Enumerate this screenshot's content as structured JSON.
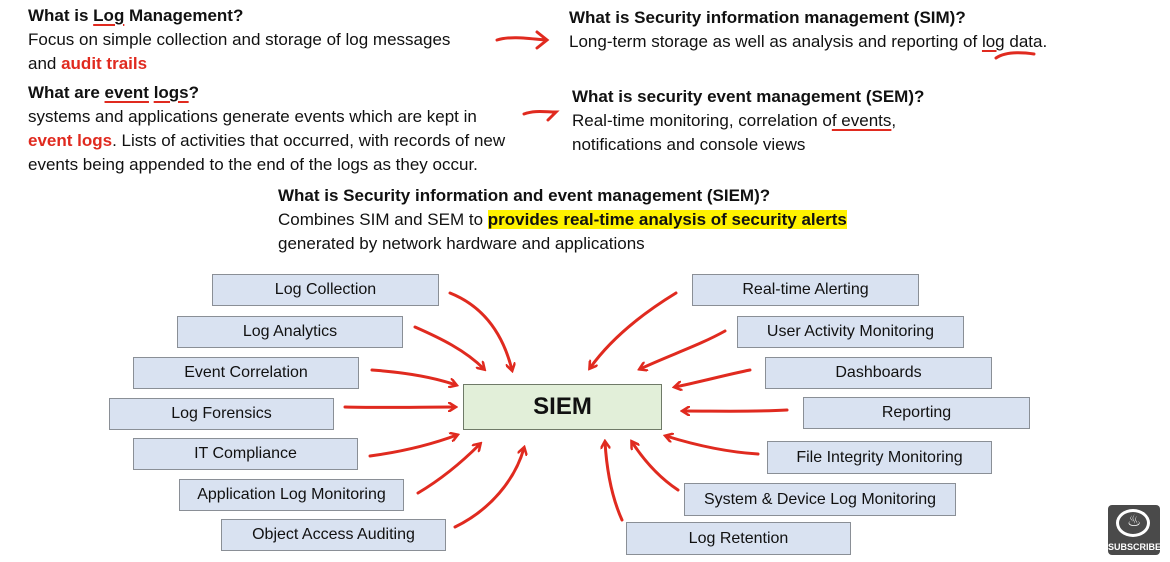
{
  "log_mgmt": {
    "title_pre": "What is ",
    "title_u": "Log",
    "title_post": " Management?",
    "body_line1": "Focus on simple collection and storage of log messages",
    "body_line2_pre": "and ",
    "body_line2_red": "audit trails"
  },
  "event_logs": {
    "title_pre": "What are ",
    "title_u1": "event",
    "title_mid": " ",
    "title_u2": "logs",
    "title_post": "?",
    "line1": "systems and applications generate events which are kept in",
    "line2_red": "event logs",
    "line2_rest": ". Lists of activities that occurred, with records of new",
    "line3": "events being appended to the end of the logs as they occur."
  },
  "sim": {
    "title": "What is Security information management (SIM)?",
    "body_pre": "Long-term storage as well as analysis and reporting of ",
    "body_u": "log",
    "body_post": " data."
  },
  "sem": {
    "title": "What is security event management (SEM)?",
    "line1_pre": "Real-time monitoring, correlation o",
    "line1_u": "f events",
    "line1_post": ",",
    "line2": "notifications and console views"
  },
  "siem_def": {
    "title": "What is Security information and event management (SIEM)?",
    "line1_pre": "Combines SIM and SEM to ",
    "line1_hl": "provides real-time analysis of security alerts",
    "line2": "generated by network hardware and applications"
  },
  "diagram": {
    "center": "SIEM",
    "left_boxes": [
      "Log Collection",
      "Log Analytics",
      "Event Correlation",
      "Log Forensics",
      "IT Compliance",
      "Application Log Monitoring",
      "Object Access Auditing"
    ],
    "right_boxes": [
      "Real-time Alerting",
      "User Activity Monitoring",
      "Dashboards",
      "Reporting",
      "File Integrity Monitoring",
      "System & Device Log Monitoring",
      "Log Retention"
    ]
  },
  "badge": {
    "label": "SUBSCRIBE",
    "icon": "freecodecamp-flame-icon"
  },
  "colors": {
    "accent_red": "#e02a1f",
    "highlight": "#fff200",
    "box_blue": "#d9e2f1",
    "center_green": "#e2efd9"
  }
}
